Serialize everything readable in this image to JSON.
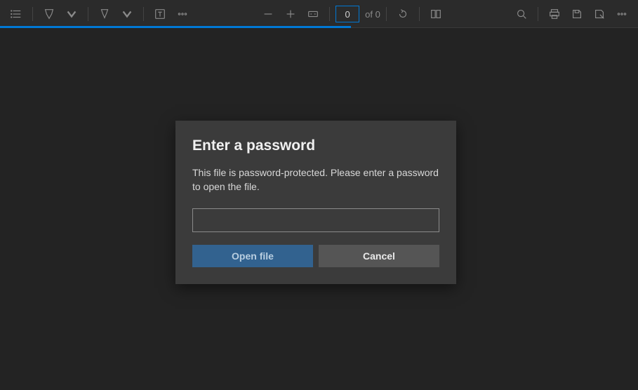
{
  "toolbar": {
    "page_input_value": "0",
    "page_of_label": "of 0"
  },
  "dialog": {
    "title": "Enter a password",
    "message": "This file is password-protected. Please enter a password to open the file.",
    "password_value": "",
    "open_label": "Open file",
    "cancel_label": "Cancel"
  },
  "progress": {
    "percent": 55
  }
}
